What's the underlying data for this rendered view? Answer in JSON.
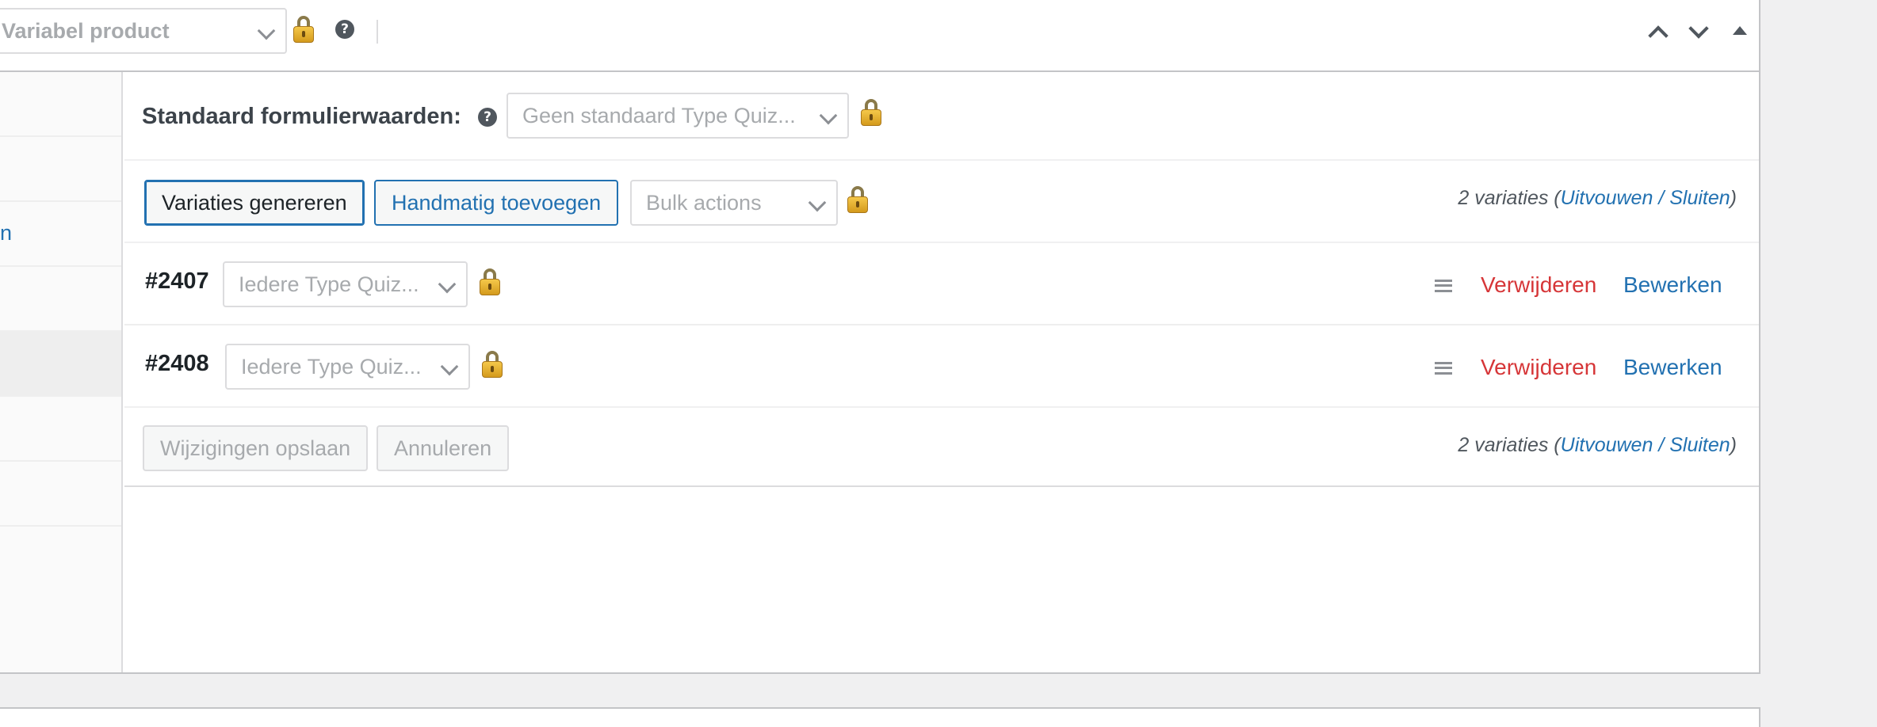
{
  "header": {
    "product_type_value": "Variabel product",
    "help_icon": "question-circle-icon",
    "lock_icon": "padlock-icon",
    "move_up_icon": "chevron-up-icon",
    "move_down_icon": "chevron-down-icon",
    "toggle_icon": "triangle-up-icon"
  },
  "sidebar": {
    "items": [
      {
        "label": ""
      },
      {
        "label": ""
      },
      {
        "label": "n"
      },
      {
        "label": ""
      },
      {
        "label": "",
        "active": true
      },
      {
        "label": ""
      },
      {
        "label": ""
      }
    ]
  },
  "defaults": {
    "label": "Standaard formulierwaarden:",
    "select_value": "Geen standaard Type Quiz..."
  },
  "toolbar": {
    "generate_label": "Variaties genereren",
    "add_manual_label": "Handmatig toevoegen",
    "bulk_actions_value": "Bulk actions",
    "count_text": "2 variaties (",
    "expand_label": "Uitvouwen",
    "slash": " / ",
    "close_label": "Sluiten",
    "paren_close": ")"
  },
  "variations": [
    {
      "id": "#2407",
      "select_value": "Iedere Type Quiz...",
      "delete_label": "Verwijderen",
      "edit_label": "Bewerken"
    },
    {
      "id": "#2408",
      "select_value": "Iedere Type Quiz...",
      "delete_label": "Verwijderen",
      "edit_label": "Bewerken"
    }
  ],
  "footer": {
    "save_label": "Wijzigingen opslaan",
    "cancel_label": "Annuleren",
    "count_text": "2 variaties (",
    "expand_label": "Uitvouwen",
    "slash": " / ",
    "close_label": "Sluiten",
    "paren_close": ")"
  },
  "colors": {
    "link": "#2271b1",
    "danger": "#d63638",
    "border": "#c3c4c7",
    "background": "#f0f0f1"
  }
}
